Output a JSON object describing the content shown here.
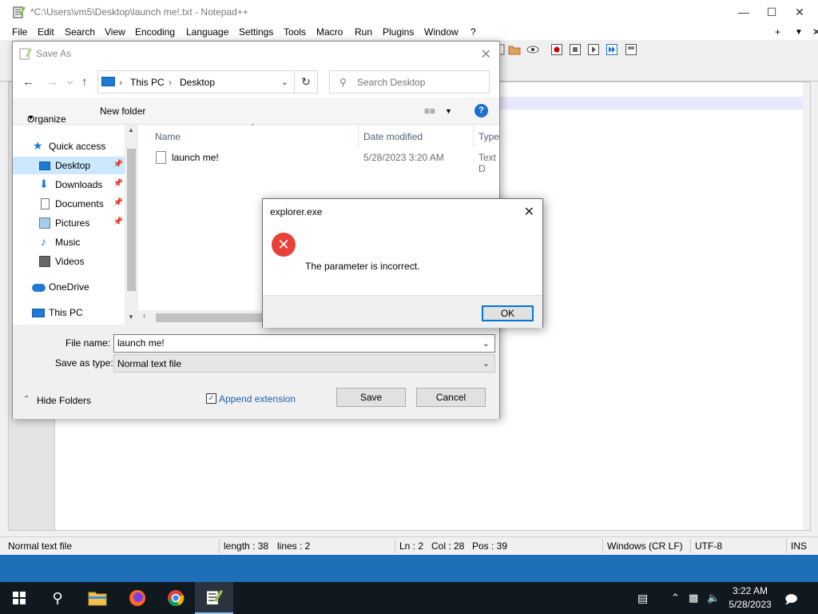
{
  "npp": {
    "title": "*C:\\Users\\vm5\\Desktop\\launch me!.txt - Notepad++",
    "menu": [
      "File",
      "Edit",
      "Search",
      "View",
      "Encoding",
      "Language",
      "Settings",
      "Tools",
      "Macro",
      "Run",
      "Plugins",
      "Window",
      "?"
    ],
    "menu_right": [
      "+",
      "▼",
      "✕"
    ],
    "status": {
      "file_type": "Normal text file",
      "length": "length : 38",
      "lines": "lines : 2",
      "ln": "Ln : 2",
      "col": "Col : 28",
      "pos": "Pos : 39",
      "eol": "Windows (CR LF)",
      "encoding": "UTF-8",
      "mode": "INS"
    }
  },
  "saveas": {
    "title": "Save As",
    "breadcrumb": [
      "This PC",
      "Desktop"
    ],
    "search_placeholder": "Search Desktop",
    "organize": "Organize",
    "new_folder": "New folder",
    "tree": [
      {
        "label": "Quick access",
        "icon": "star-icon",
        "pinned": false
      },
      {
        "label": "Desktop",
        "icon": "desktop-folder-icon",
        "pinned": true
      },
      {
        "label": "Downloads",
        "icon": "downloads-icon",
        "pinned": true
      },
      {
        "label": "Documents",
        "icon": "documents-icon",
        "pinned": true
      },
      {
        "label": "Pictures",
        "icon": "pictures-icon",
        "pinned": true
      },
      {
        "label": "Music",
        "icon": "music-icon",
        "pinned": false
      },
      {
        "label": "Videos",
        "icon": "videos-icon",
        "pinned": false
      },
      {
        "label": "OneDrive",
        "icon": "onedrive-icon",
        "pinned": false
      },
      {
        "label": "This PC",
        "icon": "this-pc-icon",
        "pinned": false
      }
    ],
    "columns": [
      "Name",
      "Date modified",
      "Type"
    ],
    "files": [
      {
        "name": "launch me!",
        "date": "5/28/2023 3:20 AM",
        "type": "Text D"
      }
    ],
    "file_name_label": "File name:",
    "file_name_value": "launch me!",
    "save_type_label": "Save as type:",
    "save_type_value": "Normal text file",
    "hide_folders": "Hide Folders",
    "append_extension": "Append extension",
    "save_button": "Save",
    "cancel_button": "Cancel"
  },
  "error": {
    "title": "explorer.exe",
    "message": "The parameter is incorrect.",
    "ok": "OK"
  },
  "taskbar": {
    "time": "3:22 AM",
    "date": "5/28/2023"
  },
  "colors": {
    "accent": "#0078d7",
    "selection": "#cce8ff",
    "error_red": "#e8413a"
  }
}
